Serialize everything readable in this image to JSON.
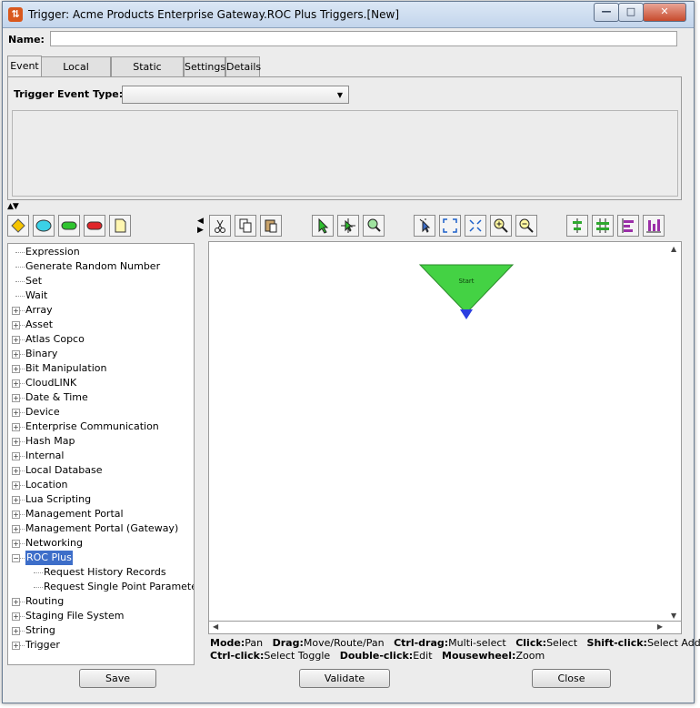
{
  "window": {
    "title": "Trigger:  Acme Products Enterprise Gateway.ROC Plus Triggers.[New]",
    "min_glyph": "—",
    "max_glyph": "□",
    "close_glyph": "✕"
  },
  "name_field": {
    "label": "Name:",
    "value": ""
  },
  "tabs": [
    {
      "label": "Event",
      "active": true
    },
    {
      "label": "Local Variables",
      "active": false
    },
    {
      "label": "Static Variables",
      "active": false
    },
    {
      "label": "Settings",
      "active": false
    },
    {
      "label": "Details",
      "active": false
    }
  ],
  "event": {
    "trigger_type_label": "Trigger Event Type:",
    "trigger_type_value": ""
  },
  "palette": [
    {
      "icon": "diamond-icon",
      "color": "#f5c400"
    },
    {
      "icon": "oval-icon",
      "color": "#3bd1e6"
    },
    {
      "icon": "green-pill-icon",
      "color": "#2fc42f"
    },
    {
      "icon": "red-pill-icon",
      "color": "#e0262a"
    },
    {
      "icon": "note-icon",
      "color": "#fff6b0"
    }
  ],
  "tree": {
    "items": [
      {
        "label": "Expression",
        "expandable": false,
        "level": 0
      },
      {
        "label": "Generate Random Number",
        "expandable": false,
        "level": 0
      },
      {
        "label": "Set",
        "expandable": false,
        "level": 0
      },
      {
        "label": "Wait",
        "expandable": false,
        "level": 0
      },
      {
        "label": "Array",
        "expandable": true,
        "level": 0
      },
      {
        "label": "Asset",
        "expandable": true,
        "level": 0
      },
      {
        "label": "Atlas Copco",
        "expandable": true,
        "level": 0
      },
      {
        "label": "Binary",
        "expandable": true,
        "level": 0
      },
      {
        "label": "Bit Manipulation",
        "expandable": true,
        "level": 0
      },
      {
        "label": "CloudLINK",
        "expandable": true,
        "level": 0
      },
      {
        "label": "Date & Time",
        "expandable": true,
        "level": 0
      },
      {
        "label": "Device",
        "expandable": true,
        "level": 0
      },
      {
        "label": "Enterprise Communication",
        "expandable": true,
        "level": 0
      },
      {
        "label": "Hash Map",
        "expandable": true,
        "level": 0
      },
      {
        "label": "Internal",
        "expandable": true,
        "level": 0
      },
      {
        "label": "Local Database",
        "expandable": true,
        "level": 0
      },
      {
        "label": "Location",
        "expandable": true,
        "level": 0
      },
      {
        "label": "Lua Scripting",
        "expandable": true,
        "level": 0
      },
      {
        "label": "Management Portal",
        "expandable": true,
        "level": 0
      },
      {
        "label": "Management Portal (Gateway)",
        "expandable": true,
        "level": 0
      },
      {
        "label": "Networking",
        "expandable": true,
        "level": 0
      },
      {
        "label": "ROC Plus",
        "expandable": true,
        "expanded": true,
        "selected": true,
        "level": 0
      },
      {
        "label": "Request History Records",
        "expandable": false,
        "level": 1
      },
      {
        "label": "Request Single Point Parameters",
        "expandable": false,
        "level": 1
      },
      {
        "label": "Routing",
        "expandable": true,
        "level": 0
      },
      {
        "label": "Staging File System",
        "expandable": true,
        "level": 0
      },
      {
        "label": "String",
        "expandable": true,
        "level": 0
      },
      {
        "label": "Trigger",
        "expandable": true,
        "level": 0
      }
    ]
  },
  "canvas_toolbar": [
    {
      "icon": "cut-icon",
      "group": 0
    },
    {
      "icon": "copy-icon",
      "group": 0
    },
    {
      "icon": "paste-icon",
      "group": 0
    },
    {
      "icon": "select-pointer-icon",
      "group": 1
    },
    {
      "icon": "pan-icon",
      "group": 1
    },
    {
      "icon": "zoom-icon",
      "group": 1
    },
    {
      "icon": "select-all-icon",
      "group": 2
    },
    {
      "icon": "fit-to-window-icon",
      "group": 2
    },
    {
      "icon": "shrink-icon",
      "group": 2
    },
    {
      "icon": "zoom-in-icon",
      "group": 2
    },
    {
      "icon": "zoom-out-icon",
      "group": 2
    },
    {
      "icon": "align-vertical-icon",
      "group": 3
    },
    {
      "icon": "distribute-icon",
      "group": 3
    },
    {
      "icon": "align-left-icon",
      "group": 3
    },
    {
      "icon": "align-bottom-icon",
      "group": 3
    }
  ],
  "canvas": {
    "start_node_label": "Start",
    "start_color": "#44d244",
    "port_color": "#2b3ee0"
  },
  "helpbar": {
    "line1": [
      {
        "key": "Mode:",
        "val": "Pan"
      },
      {
        "key": "Drag:",
        "val": "Move/Route/Pan"
      },
      {
        "key": "Ctrl-drag:",
        "val": "Multi-select"
      },
      {
        "key": "Click:",
        "val": "Select"
      },
      {
        "key": "Shift-click:",
        "val": "Select Add"
      }
    ],
    "line2": [
      {
        "key": "Ctrl-click:",
        "val": "Select Toggle"
      },
      {
        "key": "Double-click:",
        "val": "Edit"
      },
      {
        "key": "Mousewheel:",
        "val": "Zoom"
      }
    ]
  },
  "buttons": {
    "save": "Save",
    "validate": "Validate",
    "close": "Close"
  }
}
